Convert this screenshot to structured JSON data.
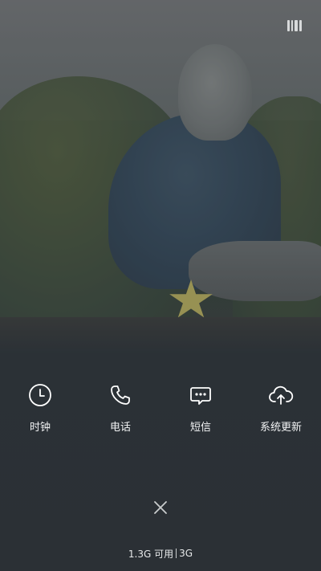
{
  "quick_actions": [
    {
      "label": "时钟",
      "icon": "clock-icon"
    },
    {
      "label": "电话",
      "icon": "phone-icon"
    },
    {
      "label": "短信",
      "icon": "message-icon"
    },
    {
      "label": "系统更新",
      "icon": "cloud-upload-icon"
    }
  ],
  "memory": {
    "available": "1.3G 可用",
    "total": "3G"
  },
  "colors": {
    "text": "#f2f3f4",
    "icon": "#ffffff",
    "overlay": "#2d3236"
  },
  "top_icon": "memory-clean-icon",
  "close_icon": "close-icon"
}
